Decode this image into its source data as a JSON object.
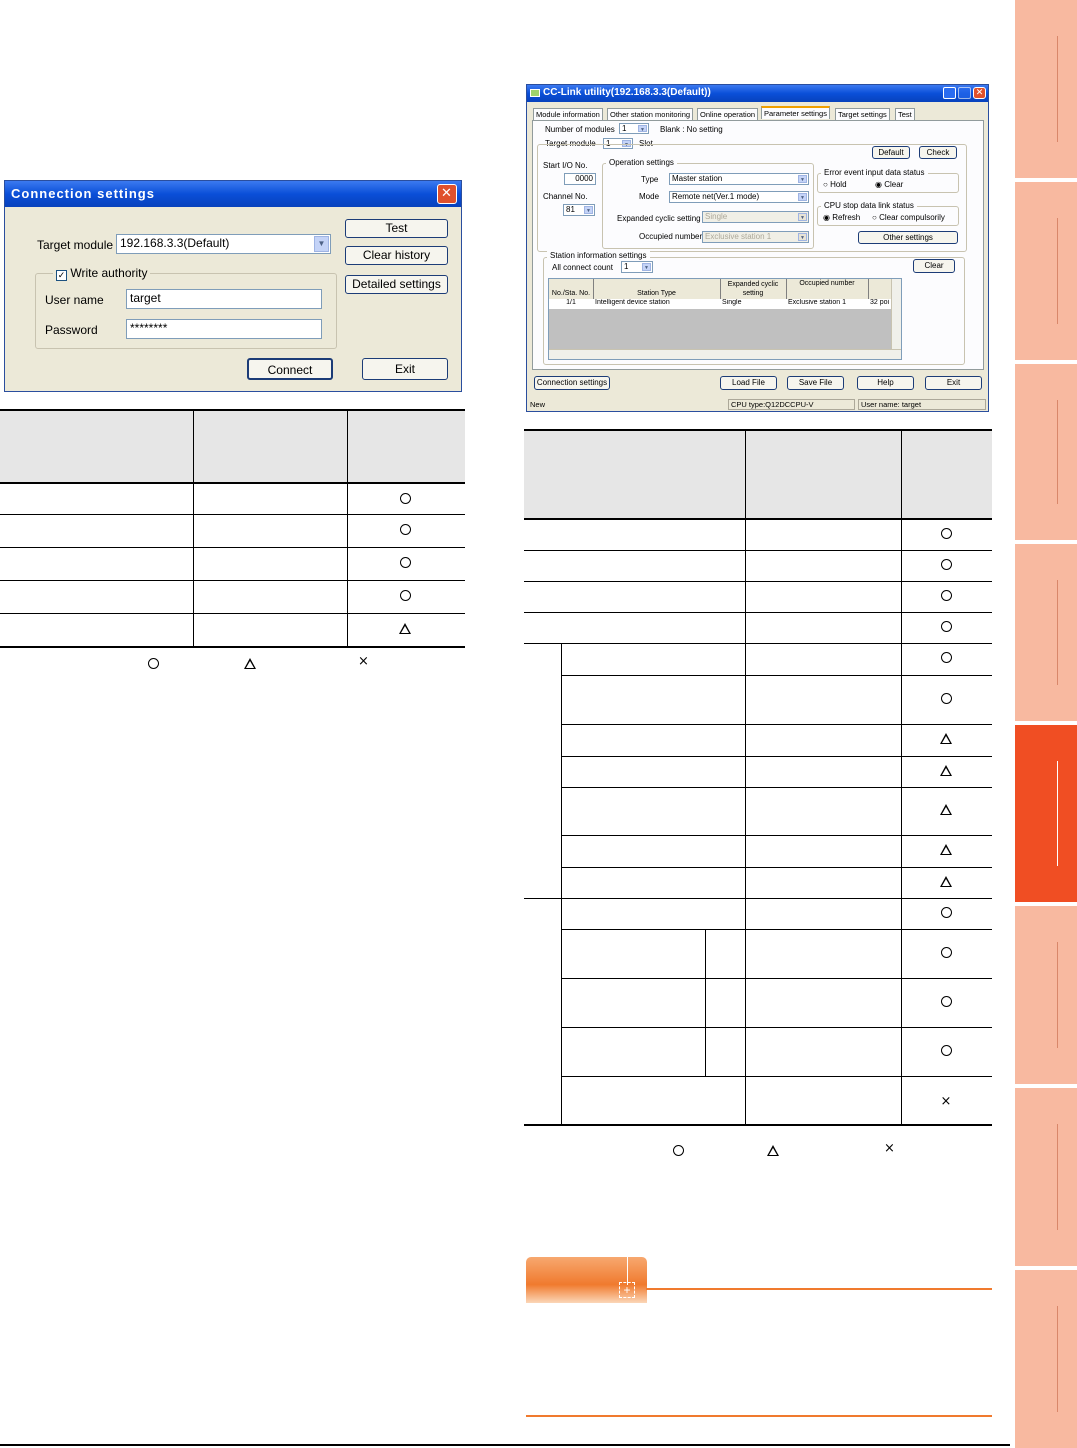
{
  "conn_dialog": {
    "title": "Connection settings",
    "target_module_label": "Target module",
    "target_module_value": "192.168.3.3(Default)",
    "write_authority_label": "Write authority",
    "user_name_label": "User name",
    "user_name_value": "target",
    "password_label": "Password",
    "password_value": "********",
    "btn_test": "Test",
    "btn_clear_history": "Clear history",
    "btn_detailed": "Detailed settings",
    "btn_connect": "Connect",
    "btn_exit": "Exit"
  },
  "utility_window": {
    "title": "CC-Link utility(192.168.3.3(Default))",
    "tabs": [
      "Module information",
      "Other station monitoring",
      "Online operation",
      "Parameter settings",
      "Target settings",
      "Test"
    ],
    "number_of_modules_label": "Number of modules",
    "number_of_modules_value": "1",
    "blank_note": "Blank : No setting",
    "target_module_label": "Target module",
    "target_module_value": "1",
    "slot_label": "Slot",
    "btn_default": "Default",
    "btn_check": "Check",
    "start_io_label": "Start I/O No.",
    "start_io_value": "0000",
    "channel_label": "Channel No.",
    "channel_value": "81",
    "operation_settings_label": "Operation settings",
    "type_label": "Type",
    "type_value": "Master station",
    "mode_label": "Mode",
    "mode_value": "Remote net(Ver.1 mode)",
    "exp_cyclic_label": "Expanded cyclic setting",
    "exp_cyclic_value": "Single",
    "occupied_label": "Occupied number",
    "occupied_value": "Exclusive station 1",
    "error_group_label": "Error event input data status",
    "hold_label": "Hold",
    "clear_label": "Clear",
    "cpu_stop_label": "CPU stop data link status",
    "refresh_label": "Refresh",
    "clear_compulsorily_label": "Clear compulsorily",
    "btn_other_settings": "Other settings",
    "station_info_label": "Station information settings",
    "all_connect_label": "All connect count",
    "all_connect_value": "1",
    "btn_clear": "Clear",
    "grid_headers": [
      "No./Sta. No.",
      "Station Type",
      "Expanded cyclic setting",
      "Occupied number",
      ""
    ],
    "grid_row": [
      "1/1",
      "Intelligent device station",
      "Single",
      "Exclusive station 1",
      "32 poi"
    ],
    "btn_connection_settings": "Connection settings",
    "btn_load_file": "Load File",
    "btn_save_file": "Save File",
    "btn_help": "Help",
    "btn_exit": "Exit",
    "status_left": "New",
    "status_mid": "CPU type:Q12DCCPU-V",
    "status_right": "User name: target"
  },
  "table_left": {
    "symbols": [
      "circle",
      "circle",
      "circle",
      "circle",
      "triangle"
    ]
  },
  "legend": {
    "symbols": [
      "circle",
      "triangle",
      "cross"
    ]
  },
  "table_right": {
    "symbols": [
      "circle",
      "circle",
      "circle",
      "circle",
      "circle",
      "circle",
      "triangle",
      "triangle",
      "triangle",
      "triangle",
      "triangle",
      "circle",
      "circle",
      "circle",
      "circle",
      "cross"
    ]
  }
}
